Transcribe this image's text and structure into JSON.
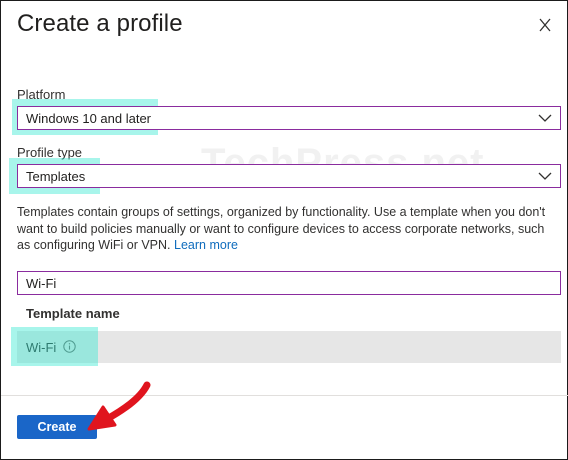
{
  "panel": {
    "title": "Create a profile",
    "close_icon": "close-icon"
  },
  "platform": {
    "label": "Platform",
    "value": "Windows 10 and later"
  },
  "profile_type": {
    "label": "Profile type",
    "value": "Templates"
  },
  "description": {
    "text": "Templates contain groups of settings, organized by functionality. Use a template when you don't want to build policies manually or want to configure devices to access corporate networks, such as configuring WiFi or VPN.",
    "link": "Learn more"
  },
  "search": {
    "value": "Wi-Fi"
  },
  "table": {
    "column_header": "Template name",
    "rows": [
      {
        "name": "Wi-Fi",
        "icon": "info-icon"
      }
    ]
  },
  "footer": {
    "create_label": "Create"
  },
  "watermark": "TechPress.net",
  "colors": {
    "accent": "#1a66c8",
    "field_border": "#8a2c9e",
    "highlight": "#3fe8d2",
    "arrow": "#e0141e"
  }
}
